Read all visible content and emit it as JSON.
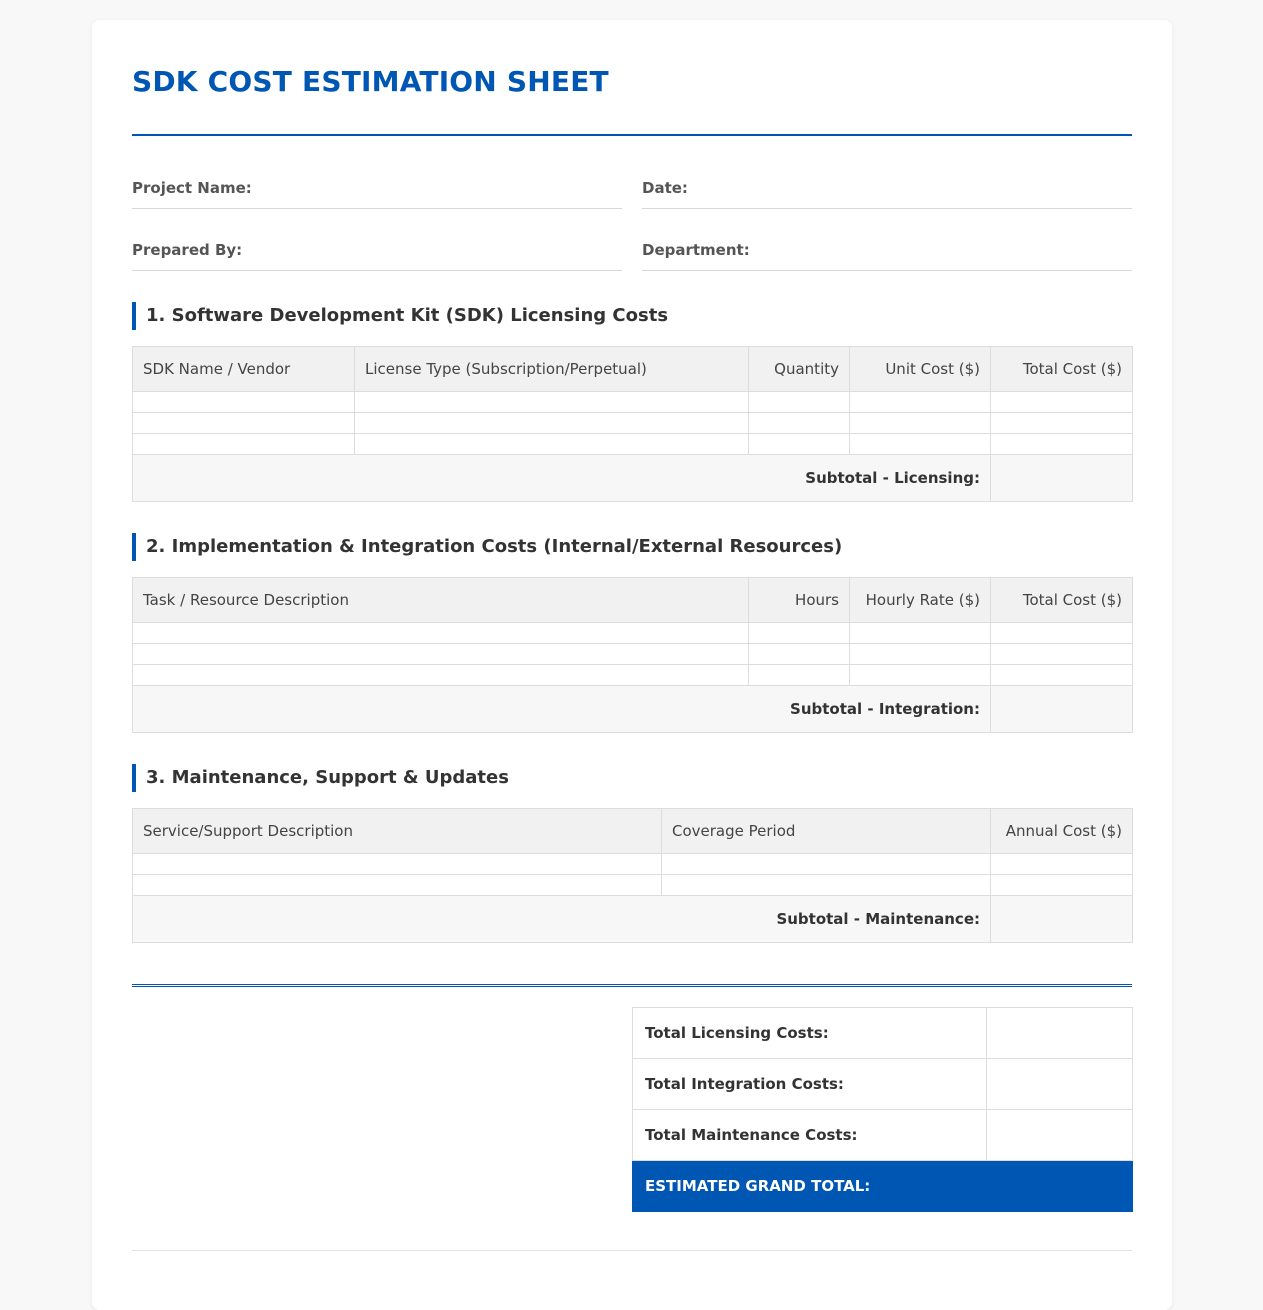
{
  "title": "SDK COST ESTIMATION SHEET",
  "fields": {
    "project_name": "Project Name:",
    "date": "Date:",
    "prepared_by": "Prepared By:",
    "department": "Department:"
  },
  "section1": {
    "heading": "1. Software Development Kit (SDK) Licensing Costs",
    "columns": [
      "SDK Name / Vendor",
      "License Type (Subscription/Perpetual)",
      "Quantity",
      "Unit Cost ($)",
      "Total Cost ($)"
    ],
    "subtotal_label": "Subtotal - Licensing:"
  },
  "section2": {
    "heading": "2. Implementation & Integration Costs (Internal/External Resources)",
    "columns": [
      "Task / Resource Description",
      "Hours",
      "Hourly Rate ($)",
      "Total Cost ($)"
    ],
    "subtotal_label": "Subtotal - Integration:"
  },
  "section3": {
    "heading": "3. Maintenance, Support & Updates",
    "columns": [
      "Service/Support Description",
      "Coverage Period",
      "Annual Cost ($)"
    ],
    "subtotal_label": "Subtotal - Maintenance:"
  },
  "totals": {
    "licensing": "Total Licensing Costs:",
    "integration": "Total Integration Costs:",
    "maintenance": "Total Maintenance Costs:",
    "grand": "ESTIMATED GRAND TOTAL:"
  },
  "colors": {
    "accent": "#0056b3"
  }
}
